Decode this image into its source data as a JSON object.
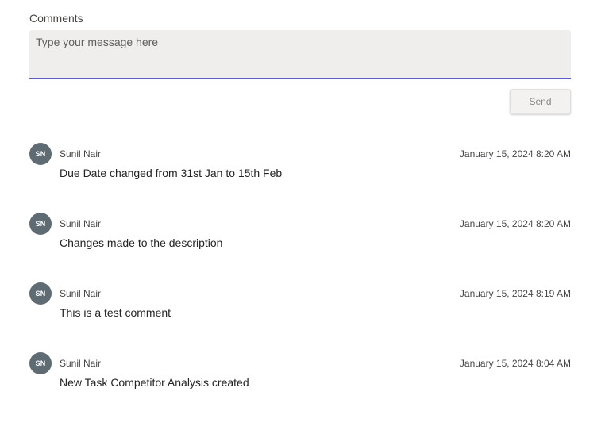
{
  "comments_section": {
    "label": "Comments",
    "input": {
      "placeholder": "Type your message here",
      "value": ""
    },
    "send_label": "Send"
  },
  "comments": [
    {
      "initials": "SN",
      "author": "Sunil Nair",
      "timestamp": "January 15, 2024 8:20 AM",
      "message": "Due Date changed from 31st Jan to 15th Feb"
    },
    {
      "initials": "SN",
      "author": "Sunil Nair",
      "timestamp": "January 15, 2024 8:20 AM",
      "message": "Changes made to the description"
    },
    {
      "initials": "SN",
      "author": "Sunil Nair",
      "timestamp": "January 15, 2024 8:19 AM",
      "message": "This is a test comment"
    },
    {
      "initials": "SN",
      "author": "Sunil Nair",
      "timestamp": "January 15, 2024 8:04 AM",
      "message": "New Task Competitor Analysis created"
    }
  ],
  "colors": {
    "accent": "#5b5fc7",
    "avatar_bg": "#5f6b73",
    "input_bg": "#f0eeec"
  }
}
